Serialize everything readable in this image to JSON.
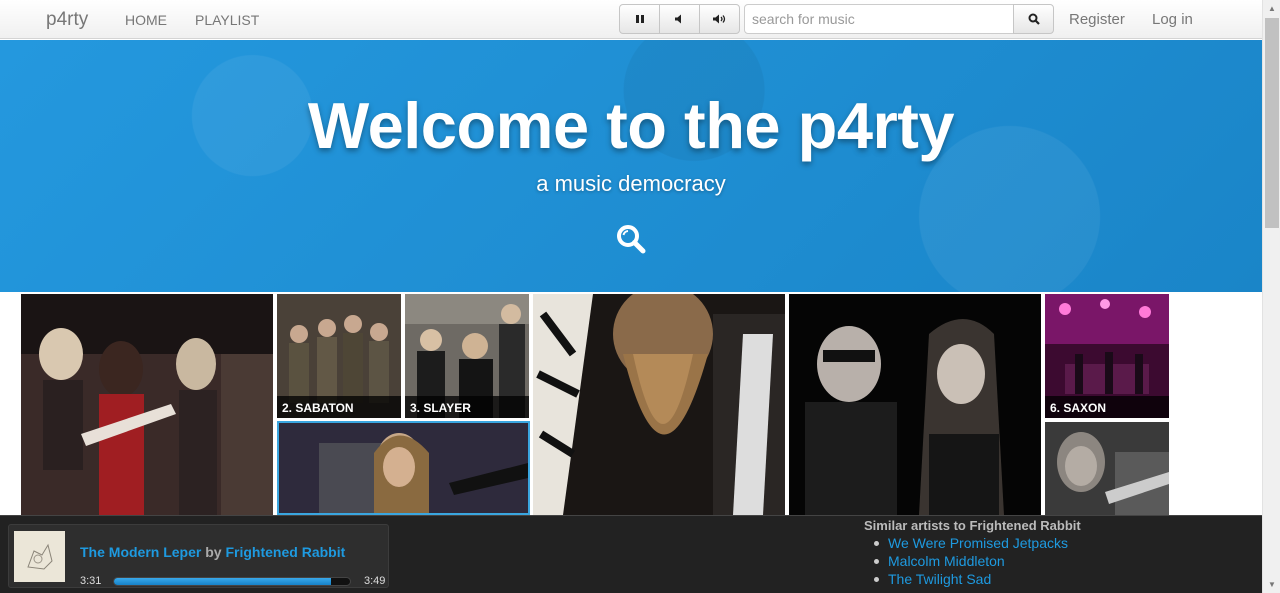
{
  "navbar": {
    "brand": "p4rty",
    "links": [
      "HOME",
      "PLAYLIST"
    ],
    "search_placeholder": "search for music",
    "register": "Register",
    "login": "Log in"
  },
  "hero": {
    "title": "Welcome to the p4rty",
    "subtitle": "a music democracy"
  },
  "grid": {
    "captions": {
      "sabaton": "2. SABATON",
      "slayer": "3. SLAYER",
      "saxon": "6. SAXON"
    }
  },
  "player": {
    "track": "The Modern Leper",
    "by": "by",
    "artist": "Frightened Rabbit",
    "elapsed": "3:31",
    "total": "3:49",
    "progress_fraction": 0.92
  },
  "similar": {
    "title": "Similar artists to Frightened Rabbit",
    "artists": [
      "We Were Promised Jetpacks",
      "Malcolm Middleton",
      "The Twilight Sad"
    ]
  },
  "colors": {
    "accent": "#1e9ae0",
    "hero_bg": "#1d8fd6"
  }
}
